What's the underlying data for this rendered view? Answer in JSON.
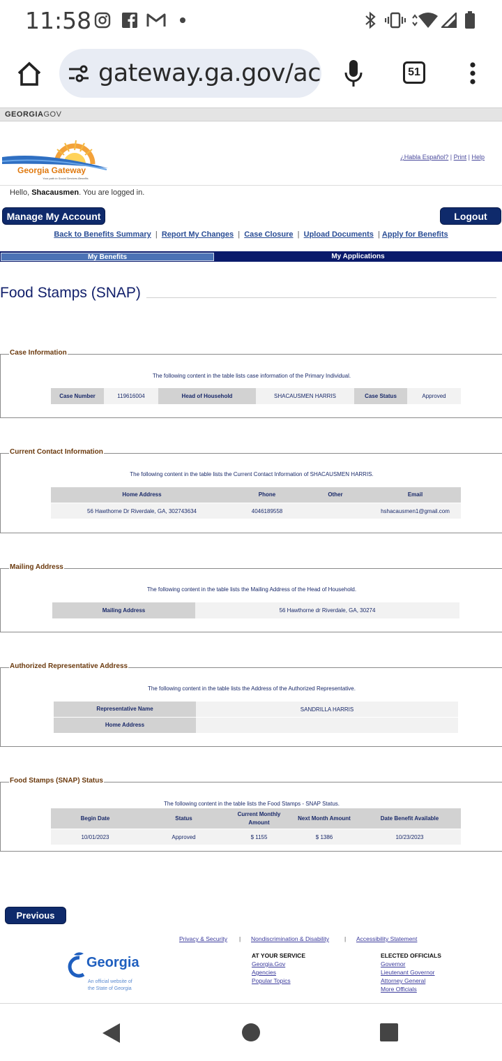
{
  "status_bar": {
    "time": "11:58",
    "icons": [
      "instagram-icon",
      "facebook-icon",
      "gmail-icon",
      "dot-icon",
      "bluetooth-icon",
      "vibrate-icon",
      "wifi-icon",
      "signal-icon",
      "battery-icon"
    ]
  },
  "browser": {
    "url": "gateway.ga.gov/ac",
    "tab_count": "51",
    "icons": [
      "home-icon",
      "site-settings-icon",
      "mic-icon",
      "tabs-icon",
      "overflow-menu-icon"
    ]
  },
  "ga_strip": {
    "bold": "GEORGIA",
    "rest": "GOV"
  },
  "header": {
    "logo_text": "Georgia Gateway",
    "logo_tagline": "Your path to Social Services Benefits",
    "links": [
      "¿Habla Español?",
      "Print",
      "Help"
    ],
    "hello_prefix": "Hello, ",
    "username": "Shacausmen",
    "hello_suffix": ". You are logged in.",
    "manage_account": "Manage My Account",
    "logout": "Logout"
  },
  "nav": {
    "links": [
      "Back to Benefits Summary",
      "Report My Changes",
      "Case Closure",
      "Upload Documents",
      "Apply for Benefits"
    ]
  },
  "tabs": {
    "my_benefits": "My Benefits",
    "my_applications": "My Applications"
  },
  "page_title": "Food Stamps (SNAP)",
  "case_info": {
    "legend": "Case Information",
    "desc": "The following content in the table lists case information of the Primary Individual.",
    "case_number_label": "Case Number",
    "case_number": "119616004",
    "hoh_label": "Head of Household",
    "hoh": "SHACAUSMEN HARRIS",
    "status_label": "Case Status",
    "status": "Approved"
  },
  "contact": {
    "legend": "Current Contact Information",
    "desc": "The following content in the table lists the Current Contact Information of SHACAUSMEN HARRIS.",
    "headers": [
      "Home Address",
      "Phone",
      "Other",
      "Email"
    ],
    "row": [
      "56 Hawthorne Dr Riverdale, GA, 302743634",
      "4046189558",
      "",
      "hshacausmen1@gmail.com"
    ]
  },
  "mailing": {
    "legend": "Mailing Address",
    "desc": "The following content in the table lists the Mailing Address of the Head of Household.",
    "label": "Mailing Address",
    "value": "56 Hawthorne dr Riverdale, GA, 30274"
  },
  "auth_rep": {
    "legend": "Authorized Representative Address",
    "desc": "The following content in the table lists the Address of the Authorized Representative.",
    "name_label": "Representative Name",
    "name": "SANDRILLA HARRIS",
    "address_label": "Home Address",
    "address": ""
  },
  "snap_status": {
    "legend": "Food Stamps (SNAP) Status",
    "desc": "The following content in the table lists the Food Stamps - SNAP Status.",
    "headers": [
      "Begin Date",
      "Status",
      "Current Monthly Amount",
      "Next Month Amount",
      "Date Benefit Available"
    ],
    "row": [
      "10/01/2023",
      "Approved",
      "$ 1155",
      "$ 1386",
      "10/23/2023"
    ]
  },
  "previous_button": "Previous",
  "footer": {
    "links": [
      "Privacy & Security",
      "Nondiscrimination & Disability",
      "Accessibility Statement"
    ],
    "georgia_logo": "Georgia",
    "georgia_tagline_1": "An official website of",
    "georgia_tagline_2": "the State of Georgia",
    "at_your_service_heading": "AT YOUR SERVICE",
    "at_your_service": [
      "Georgia.Gov",
      "Agencies",
      "Popular Topics"
    ],
    "elected_heading": "ELECTED OFFICIALS",
    "elected": [
      "Governor",
      "Lieutenant Governor",
      "Attorney General",
      "More Officials"
    ]
  },
  "colors": {
    "navy": "#0f2a6b",
    "tab_blue": "#4b72b5",
    "legend_brown": "#6b3a0e",
    "link_blue": "#2a4d95"
  }
}
